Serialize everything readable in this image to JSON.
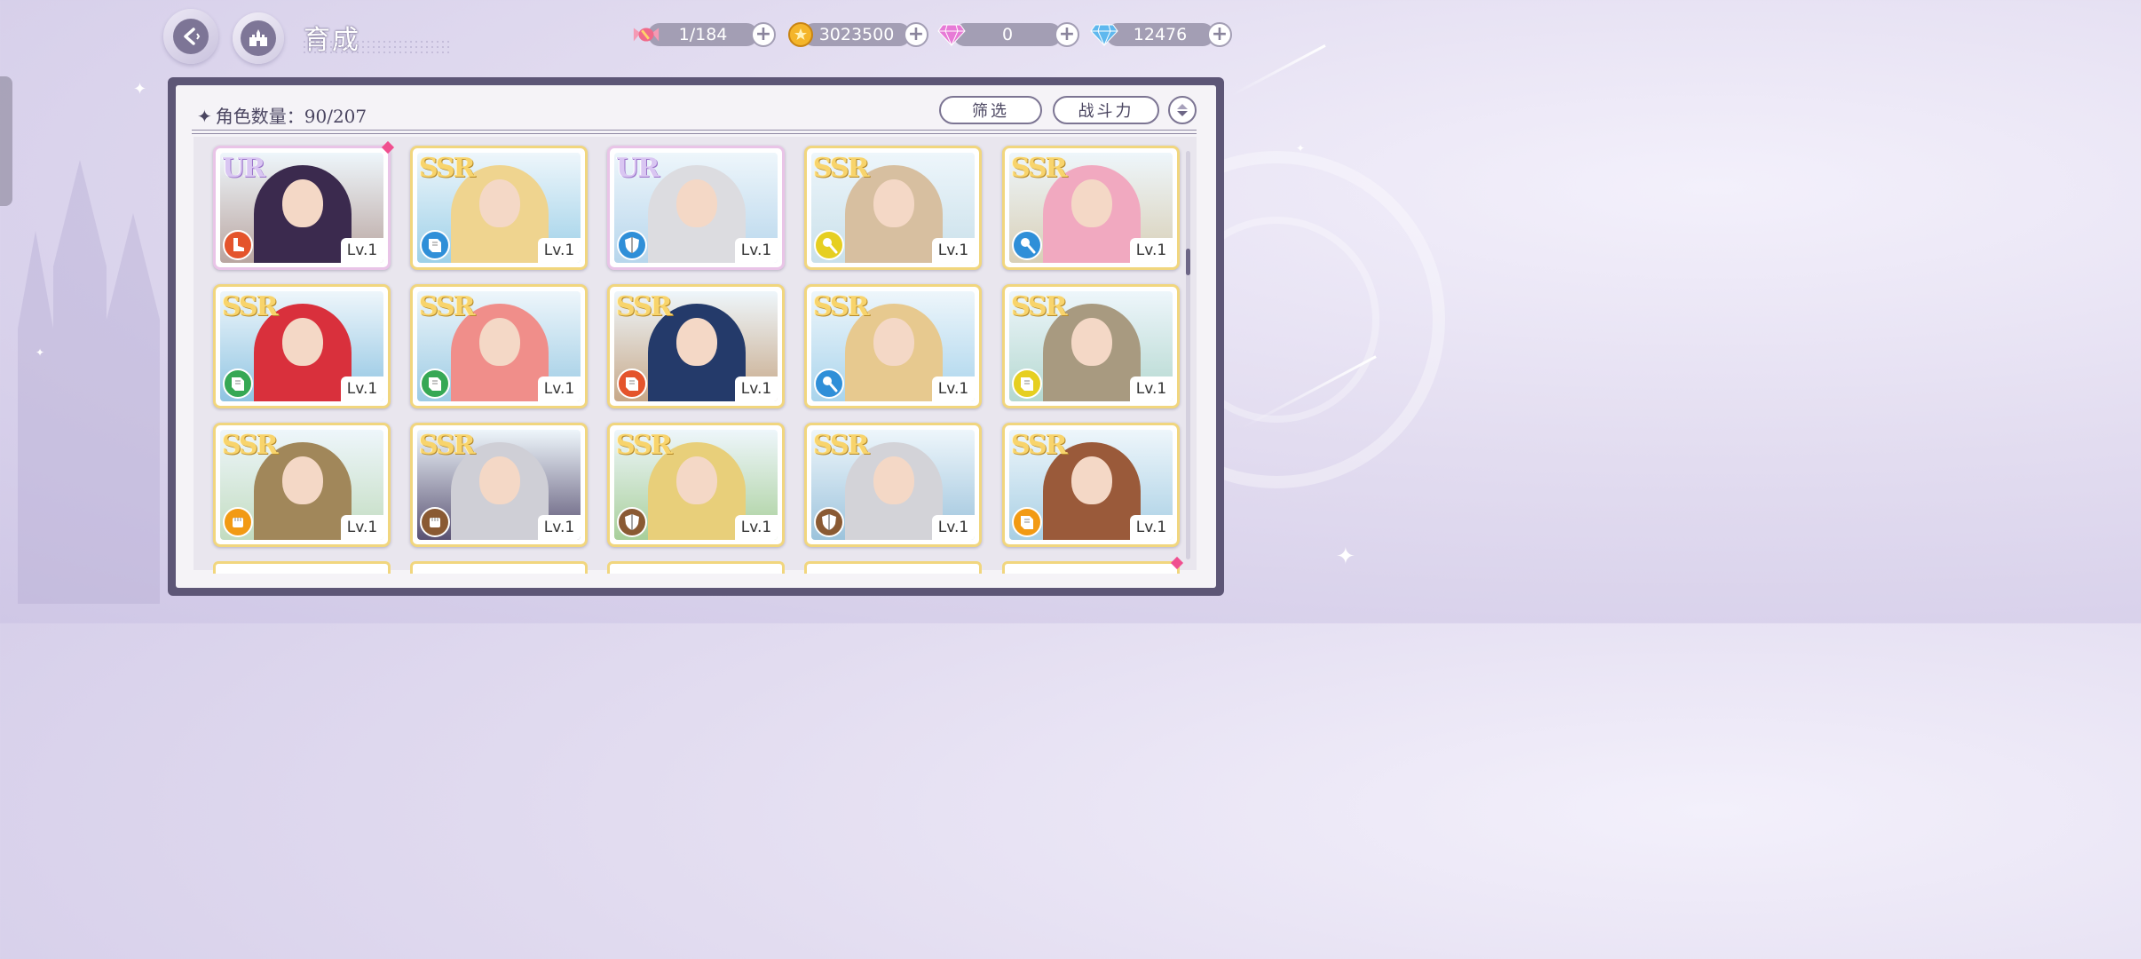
{
  "header": {
    "title": "育成",
    "icons": {
      "back": "back-arrow-icon",
      "home": "castle-home-icon"
    }
  },
  "resources": [
    {
      "name": "candy",
      "icon": "candy-icon",
      "value": "1/184",
      "color": "#f06a8a"
    },
    {
      "name": "gold",
      "icon": "gold-coin-icon",
      "value": "3023500",
      "color": "#f4b52a"
    },
    {
      "name": "pink-gem",
      "icon": "pink-diamond-icon",
      "value": "0",
      "color": "#e77ad6"
    },
    {
      "name": "blue-gem",
      "icon": "blue-diamond-icon",
      "value": "12476",
      "color": "#5fb8ee"
    }
  ],
  "roster": {
    "count_label": "角色数量：90/207",
    "filter_label": "筛选",
    "sort_label": "战斗力"
  },
  "cards": [
    {
      "rarity": "UR",
      "class": "boot-icon",
      "class_color": "#e4542c",
      "level": "Lv.1",
      "hair": "#3b2a4e",
      "bg": "#b9a5a0",
      "new": true
    },
    {
      "rarity": "SSR",
      "class": "book-icon",
      "class_color": "#2f8fd8",
      "level": "Lv.1",
      "hair": "#efd48f",
      "bg": "#9dd0e8",
      "new": false
    },
    {
      "rarity": "UR",
      "class": "shield-icon",
      "class_color": "#2f8fd8",
      "level": "Lv.1",
      "hair": "#dcdce0",
      "bg": "#b7d6ec",
      "new": false
    },
    {
      "rarity": "SSR",
      "class": "wand-icon",
      "class_color": "#e6cf21",
      "level": "Lv.1",
      "hair": "#d7bfa0",
      "bg": "#c9e0ea",
      "new": false
    },
    {
      "rarity": "SSR",
      "class": "wand-icon",
      "class_color": "#2f8fd8",
      "level": "Lv.1",
      "hair": "#f1a9c0",
      "bg": "#d8cfb6",
      "new": false
    },
    {
      "rarity": "SSR",
      "class": "book-icon",
      "class_color": "#36a854",
      "level": "Lv.1",
      "hair": "#d9303c",
      "bg": "#8fc4e2",
      "new": false
    },
    {
      "rarity": "SSR",
      "class": "book-icon",
      "class_color": "#36a854",
      "level": "Lv.1",
      "hair": "#f08e8a",
      "bg": "#9ccbe4",
      "new": false
    },
    {
      "rarity": "SSR",
      "class": "book-icon",
      "class_color": "#e4542c",
      "level": "Lv.1",
      "hair": "#243a6a",
      "bg": "#c7a888",
      "new": false
    },
    {
      "rarity": "SSR",
      "class": "wand-icon",
      "class_color": "#2f8fd8",
      "level": "Lv.1",
      "hair": "#e7c98f",
      "bg": "#a9d4ec",
      "new": false
    },
    {
      "rarity": "SSR",
      "class": "book-icon",
      "class_color": "#e6cf21",
      "level": "Lv.1",
      "hair": "#a89a80",
      "bg": "#b4d8d0",
      "new": false
    },
    {
      "rarity": "SSR",
      "class": "fist-icon",
      "class_color": "#f29a14",
      "level": "Lv.1",
      "hair": "#a1875a",
      "bg": "#c2dcc0",
      "new": false
    },
    {
      "rarity": "SSR",
      "class": "fist-icon",
      "class_color": "#8a5a33",
      "level": "Lv.1",
      "hair": "#cfcfd6",
      "bg": "#5a5273",
      "new": false
    },
    {
      "rarity": "SSR",
      "class": "shield-icon",
      "class_color": "#8a5a33",
      "level": "Lv.1",
      "hair": "#e8cf7a",
      "bg": "#a8cf9a",
      "new": false
    },
    {
      "rarity": "SSR",
      "class": "shield-icon",
      "class_color": "#8a5a33",
      "level": "Lv.1",
      "hair": "#d3d3d8",
      "bg": "#9cc3dc",
      "new": false
    },
    {
      "rarity": "SSR",
      "class": "book-icon",
      "class_color": "#f29a14",
      "level": "Lv.1",
      "hair": "#9a5a3a",
      "bg": "#a8cfe4",
      "new": false
    }
  ]
}
